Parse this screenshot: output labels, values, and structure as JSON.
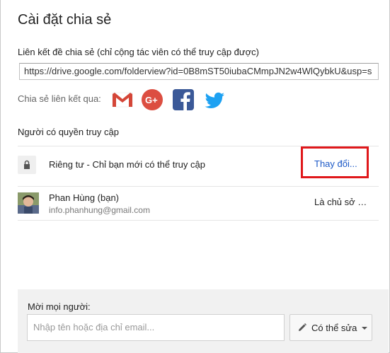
{
  "dialog": {
    "title": "Cài đặt chia sẻ"
  },
  "share_link": {
    "label": "Liên kết đề chia sẻ (chỉ cộng tác viên có thể truy cập được)",
    "url": "https://drive.google.com/folderview?id=0B8mST50iubaCMmpJN2w4WlQybkU&usp=s"
  },
  "share_via": {
    "label": "Chia sẻ liên kết qua:",
    "services": [
      "gmail-icon",
      "google-plus-icon",
      "facebook-icon",
      "twitter-icon"
    ]
  },
  "access": {
    "section_label": "Người có quyền truy cập",
    "privacy_text": "Riêng tư - Chỉ bạn mới có thể truy cập",
    "change_label": "Thay đổi...",
    "owner": {
      "name": "Phan Hùng (bạn)",
      "email": "info.phanhung@gmail.com",
      "role": "Là chủ sở …"
    }
  },
  "invite": {
    "label": "Mời mọi người:",
    "placeholder": "Nhập tên hoặc địa chỉ email...",
    "permission_label": "Có thể sửa"
  },
  "colors": {
    "link_blue": "#1a57c6",
    "highlight_red": "#e0181b",
    "facebook_blue": "#3b5998",
    "twitter_blue": "#1da1f2",
    "gplus_red": "#dc4e41",
    "gmail_red": "#d44638"
  }
}
